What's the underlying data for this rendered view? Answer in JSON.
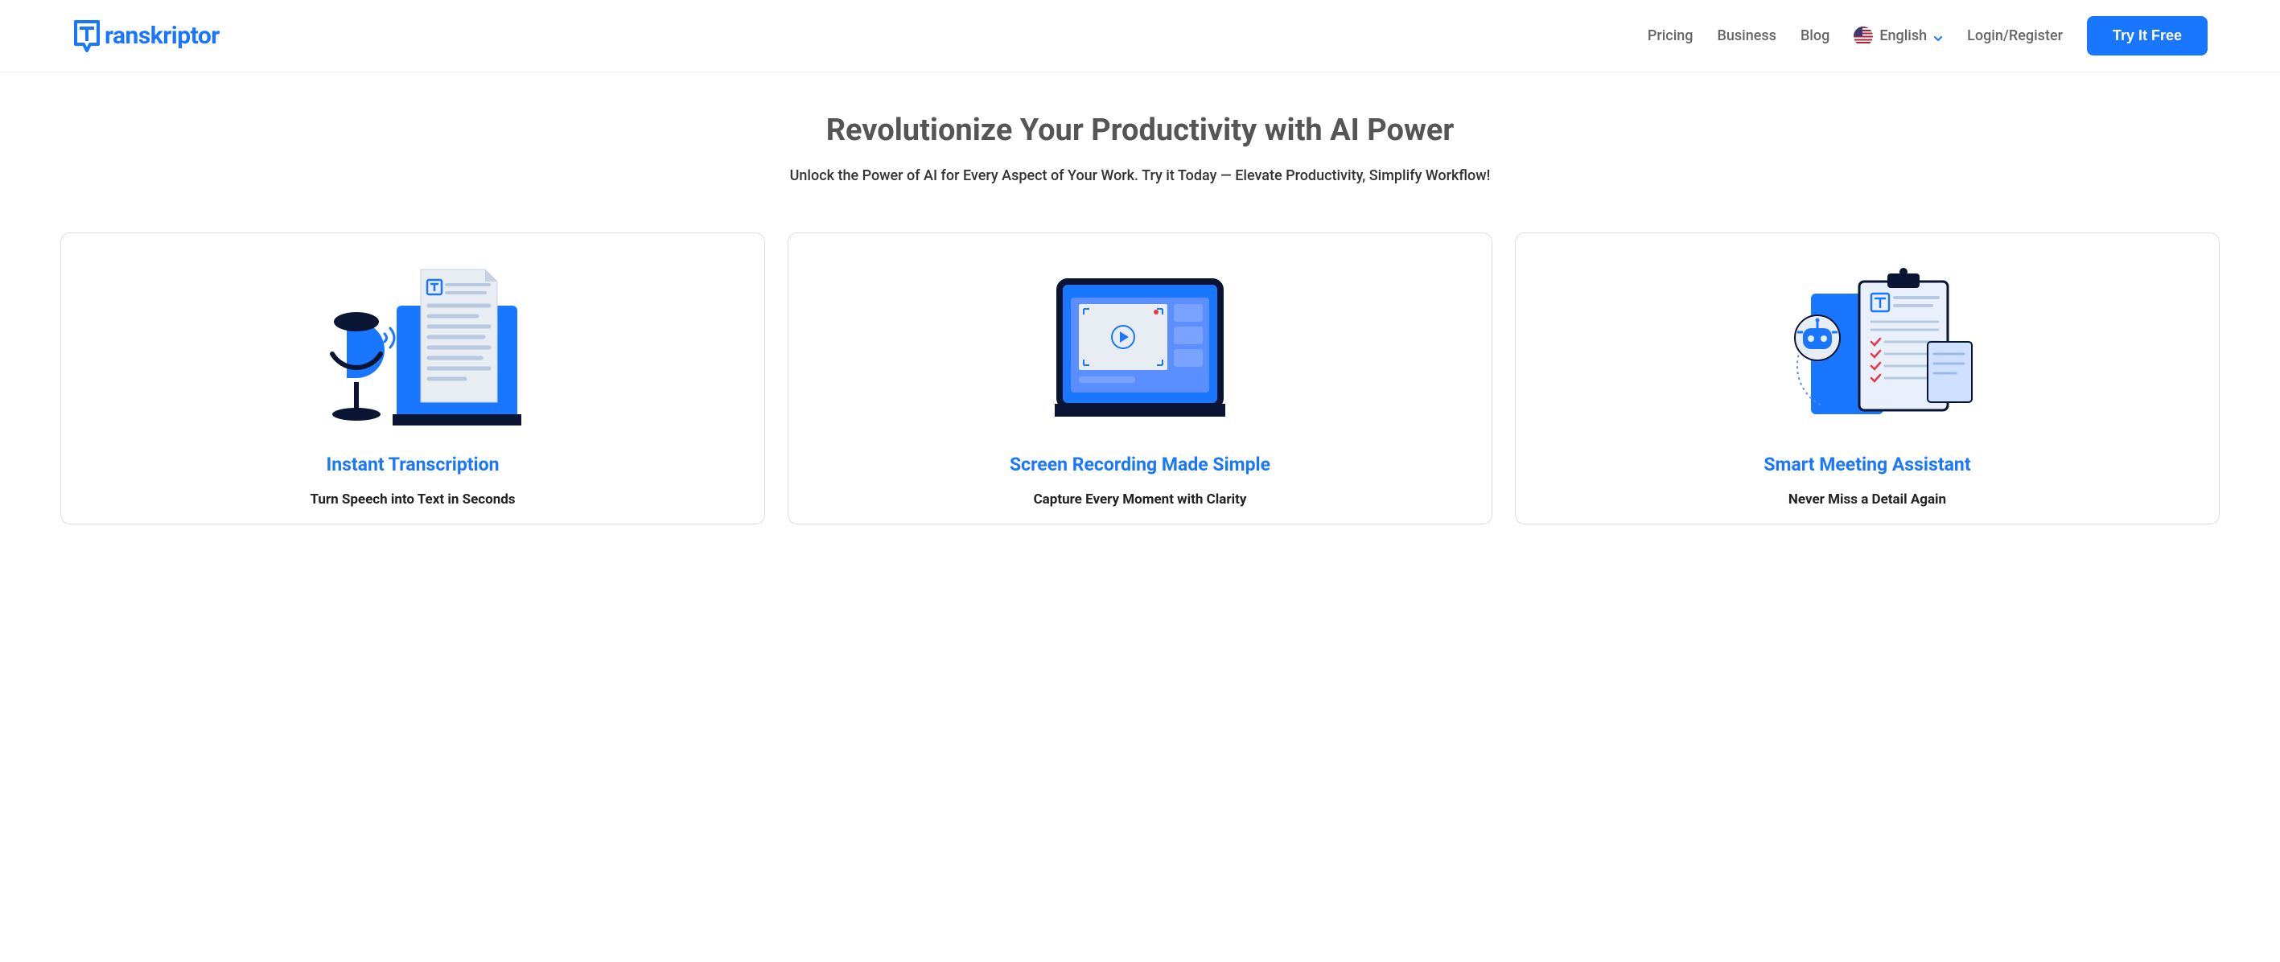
{
  "logo": {
    "text": "ranskriptor"
  },
  "nav": {
    "pricing": "Pricing",
    "business": "Business",
    "blog": "Blog",
    "language": "English",
    "login": "Login/Register",
    "cta": "Try It Free"
  },
  "hero": {
    "headline": "Revolutionize Your Productivity with AI Power",
    "subheadline": "Unlock the Power of AI for Every Aspect of Your Work. Try it Today — Elevate Productivity, Simplify Workflow!"
  },
  "cards": [
    {
      "title": "Instant Transcription",
      "subtitle": "Turn Speech into Text in Seconds"
    },
    {
      "title": "Screen Recording Made Simple",
      "subtitle": "Capture Every Moment with Clarity"
    },
    {
      "title": "Smart Meeting Assistant",
      "subtitle": "Never Miss a Detail Again"
    }
  ]
}
